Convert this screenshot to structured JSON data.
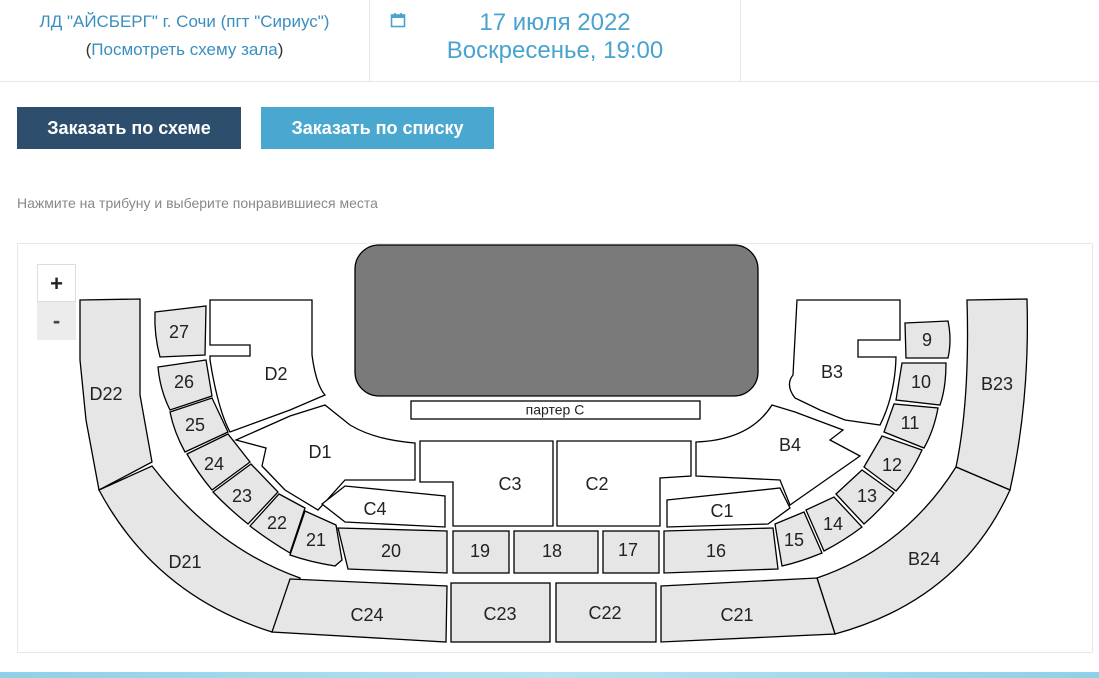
{
  "header": {
    "venue_name": "ЛД \"АЙСБЕРГ\" г. Сочи (пгт \"Сириус\")",
    "scheme_open": "(",
    "scheme_link": "Посмотреть схему зала",
    "scheme_close": ")",
    "calendar_icon": "calendar-icon",
    "date": "17 июля 2022",
    "weekday_time": "Воскресенье, 19:00"
  },
  "buttons": {
    "scheme": "Заказать по схеме",
    "list": "Заказать по списку"
  },
  "hint": "Нажмите на трибуну и выберите понравившиеся места",
  "zoom": {
    "in": "+",
    "out": "-"
  },
  "map": {
    "colors": {
      "section": "#e6e6e6",
      "stage": "#7a7a7a",
      "active_button": "#2e4e6d",
      "button": "#4aa8d0"
    },
    "sections": {
      "parter_c": "партер C",
      "d1": "D1",
      "d2": "D2",
      "d21": "D21",
      "d22": "D22",
      "b3": "B3",
      "b4": "B4",
      "b23": "B23",
      "b24": "B24",
      "c1": "C1",
      "c2": "C2",
      "c3": "C3",
      "c4": "C4",
      "c21": "C21",
      "c22": "C22",
      "c23": "C23",
      "c24": "C24",
      "s9": "9",
      "s10": "10",
      "s11": "11",
      "s12": "12",
      "s13": "13",
      "s14": "14",
      "s15": "15",
      "s16": "16",
      "s17": "17",
      "s18": "18",
      "s19": "19",
      "s20": "20",
      "s21": "21",
      "s22": "22",
      "s23": "23",
      "s24": "24",
      "s25": "25",
      "s26": "26",
      "s27": "27"
    }
  }
}
